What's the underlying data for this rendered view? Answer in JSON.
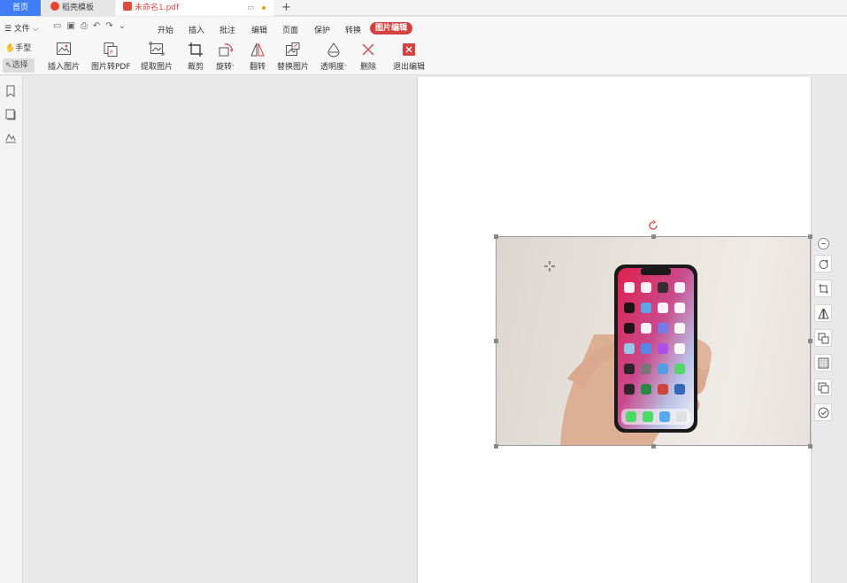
{
  "tabs": {
    "home": "首页",
    "templates": "稻壳模板",
    "document": "未命名1.pdf",
    "add": "+"
  },
  "menu": {
    "file": "☰ 文件 ⌵",
    "items": [
      "开始",
      "插入",
      "批注",
      "编辑",
      "页面",
      "保护",
      "转换"
    ],
    "active": "图片编辑"
  },
  "ribbon": {
    "hand": "手型",
    "select": "选择",
    "buttons": [
      {
        "label": "插入图片",
        "icon": "insert-image-icon"
      },
      {
        "label": "图片转PDF",
        "icon": "image-to-pdf-icon"
      },
      {
        "label": "提取图片",
        "icon": "extract-image-icon"
      },
      {
        "label": "裁剪",
        "icon": "crop-icon"
      },
      {
        "label": "旋转",
        "icon": "rotate-icon"
      },
      {
        "label": "翻转",
        "icon": "flip-icon"
      },
      {
        "label": "替换图片",
        "icon": "replace-image-icon"
      },
      {
        "label": "透明度",
        "icon": "transparency-icon"
      },
      {
        "label": "删除",
        "icon": "delete-icon"
      },
      {
        "label": "退出编辑",
        "icon": "exit-edit-icon"
      }
    ]
  },
  "colors": {
    "accent_red": "#d4413f",
    "home_tab_blue": "#3f7ef7"
  }
}
